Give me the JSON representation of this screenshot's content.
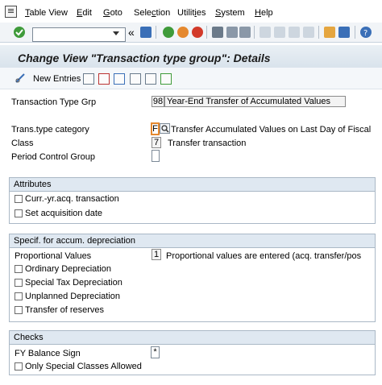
{
  "menu": {
    "items": [
      {
        "u": "T",
        "rest": "able View"
      },
      {
        "u": "E",
        "rest": "dit"
      },
      {
        "u": "G",
        "rest": "oto"
      },
      {
        "u": "",
        "pre": "Sele",
        "mid": "c",
        "rest": "tion"
      },
      {
        "u": "",
        "pre": "Utilit",
        "mid": "i",
        "rest": "es"
      },
      {
        "u": "S",
        "rest": "ystem"
      },
      {
        "u": "H",
        "rest": "elp"
      }
    ]
  },
  "toolbar": {
    "command_field_value": "",
    "back_glyph": "«"
  },
  "title": "Change View \"Transaction type group\": Details",
  "app_toolbar": {
    "new_entries_label": "New Entries"
  },
  "form": {
    "transaction_type_grp": {
      "label": "Transaction Type Grp",
      "value": "98",
      "description": "Year-End Transfer of Accumulated Values"
    },
    "trans_type_category": {
      "label": "Trans.type category",
      "value": "F",
      "description": "Transfer Accumulated Values on Last Day of Fiscal"
    },
    "class": {
      "label": "Class",
      "value": "7",
      "description": "Transfer transaction"
    },
    "period_control_group": {
      "label": "Period Control Group",
      "value": ""
    }
  },
  "attributes": {
    "heading": "Attributes",
    "checkboxes": [
      {
        "label": "Curr.-yr.acq. transaction",
        "checked": false
      },
      {
        "label": "Set acquisition date",
        "checked": false
      }
    ]
  },
  "accum_depreciation": {
    "heading": "Specif. for accum. depreciation",
    "proportional_values": {
      "label": "Proportional Values",
      "value": "1",
      "description": "Proportional values are entered (acq. transfer/pos"
    },
    "checkboxes": [
      {
        "label": "Ordinary Depreciation",
        "checked": false
      },
      {
        "label": "Special Tax Depreciation",
        "checked": false
      },
      {
        "label": "Unplanned Depreciation",
        "checked": false
      },
      {
        "label": "Transfer of reserves",
        "checked": false
      }
    ]
  },
  "checks": {
    "heading": "Checks",
    "fy_balance_sign": {
      "label": "FY Balance Sign",
      "value": "*"
    },
    "checkboxes": [
      {
        "label": "Only Special Classes Allowed",
        "checked": false
      }
    ]
  },
  "colors": {
    "ok_green": "#3f9b3a",
    "exit_orange": "#e5892f",
    "cancel_red": "#d23a2a",
    "group_header": "#dfe8f1"
  }
}
